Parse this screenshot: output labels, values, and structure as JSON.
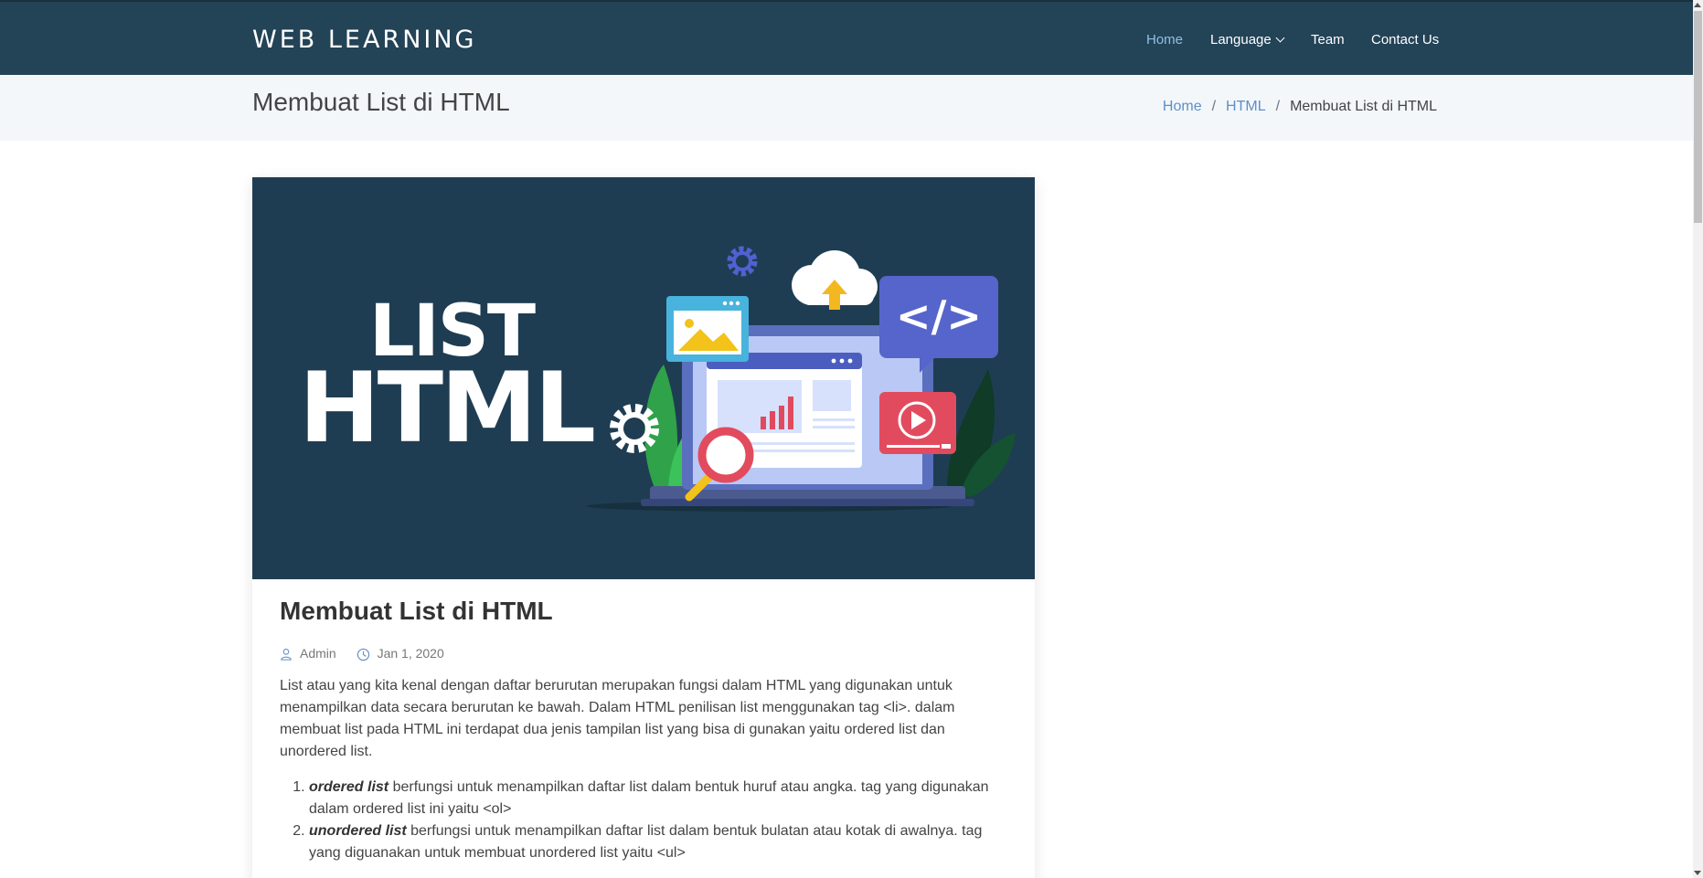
{
  "header": {
    "brand": "WEB LEARNING",
    "nav": [
      {
        "label": "Home",
        "active": true
      },
      {
        "label": "Language",
        "dropdown": true
      },
      {
        "label": "Team"
      },
      {
        "label": "Contact Us"
      }
    ]
  },
  "breadcrumbs": {
    "title": "Membuat List di HTML",
    "items": [
      "Home",
      "HTML",
      "Membuat List di HTML"
    ],
    "separator": "/"
  },
  "article": {
    "hero": {
      "line1": "LIST",
      "line2": "HTML"
    },
    "title": "Membuat List di HTML",
    "author": "Admin",
    "date": "Jan 1, 2020",
    "intro": "List atau yang kita kenal dengan daftar berurutan merupakan fungsi dalam HTML yang digunakan untuk menampilkan data secara berurutan ke bawah. Dalam HTML penilisan list menggunakan tag <li>. dalam membuat list pada HTML ini terdapat dua jenis tampilan list yang bisa di gunakan yaitu ordered list dan unordered list.",
    "list": [
      {
        "term": "ordered list",
        "text": " berfungsi untuk menampilkan daftar list dalam bentuk huruf atau angka. tag yang digunakan dalam ordered list ini yaitu <ol>"
      },
      {
        "term": "unordered list",
        "text": " berfungsi untuk menampilkan daftar list dalam bentuk bulatan atau kotak di awalnya. tag yang diguanakan untuk membuat unordered list yaitu  <ul>"
      }
    ]
  },
  "colors": {
    "header_bg": "#234357",
    "hero_bg": "#1f3d52",
    "link": "#5f8fc6",
    "active_nav": "#8fc1e3",
    "breadcrumb_bg": "#f3f7fa"
  }
}
